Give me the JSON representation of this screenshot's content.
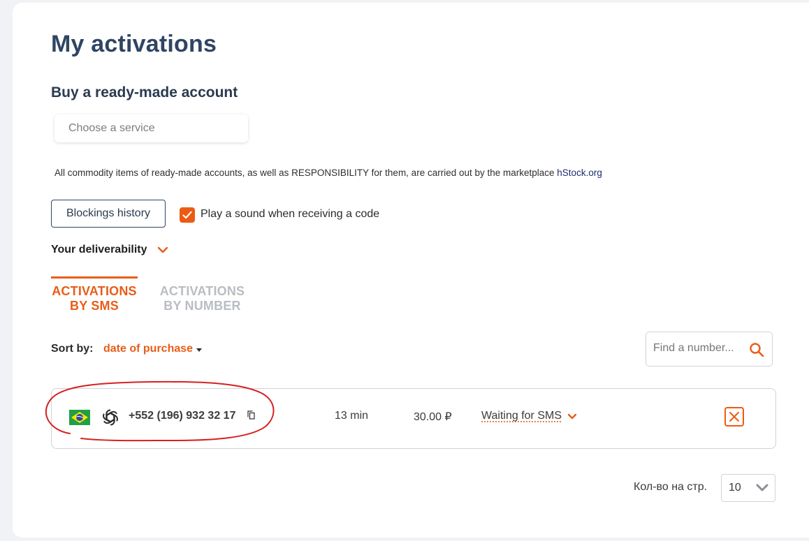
{
  "page": {
    "title": "My activations"
  },
  "buy_section": {
    "title": "Buy a ready-made account",
    "service_placeholder": "Choose a service"
  },
  "notice": {
    "text": "All commodity items of ready-made accounts, as well as RESPONSIBILITY for them, are carried out by the marketplace ",
    "link_text": "hStock.org"
  },
  "controls": {
    "blockings_history": "Blockings history",
    "sound_checkbox_label": "Play a sound when receiving a code",
    "sound_checkbox_checked": true,
    "deliverability_label": "Your deliverability"
  },
  "tabs": [
    {
      "line1": "ACTIVATIONS",
      "line2": "BY SMS",
      "active": true
    },
    {
      "line1": "ACTIVATIONS",
      "line2": "BY NUMBER",
      "active": false
    }
  ],
  "sort": {
    "label": "Sort by:",
    "value": "date of purchase"
  },
  "search": {
    "placeholder": "Find a number..."
  },
  "activations": [
    {
      "country_flag": "brazil-flag",
      "service_icon": "openai-icon",
      "phone": "+552 (196) 932 32 17",
      "time_left": "13 min",
      "price": "30.00 ₽",
      "status": "Waiting for SMS"
    }
  ],
  "pagination": {
    "per_page_label": "Кол-во на стр.",
    "per_page_value": "10"
  },
  "colors": {
    "accent": "#e85d18",
    "title": "#2f4563",
    "annotation": "#d81f1f"
  }
}
